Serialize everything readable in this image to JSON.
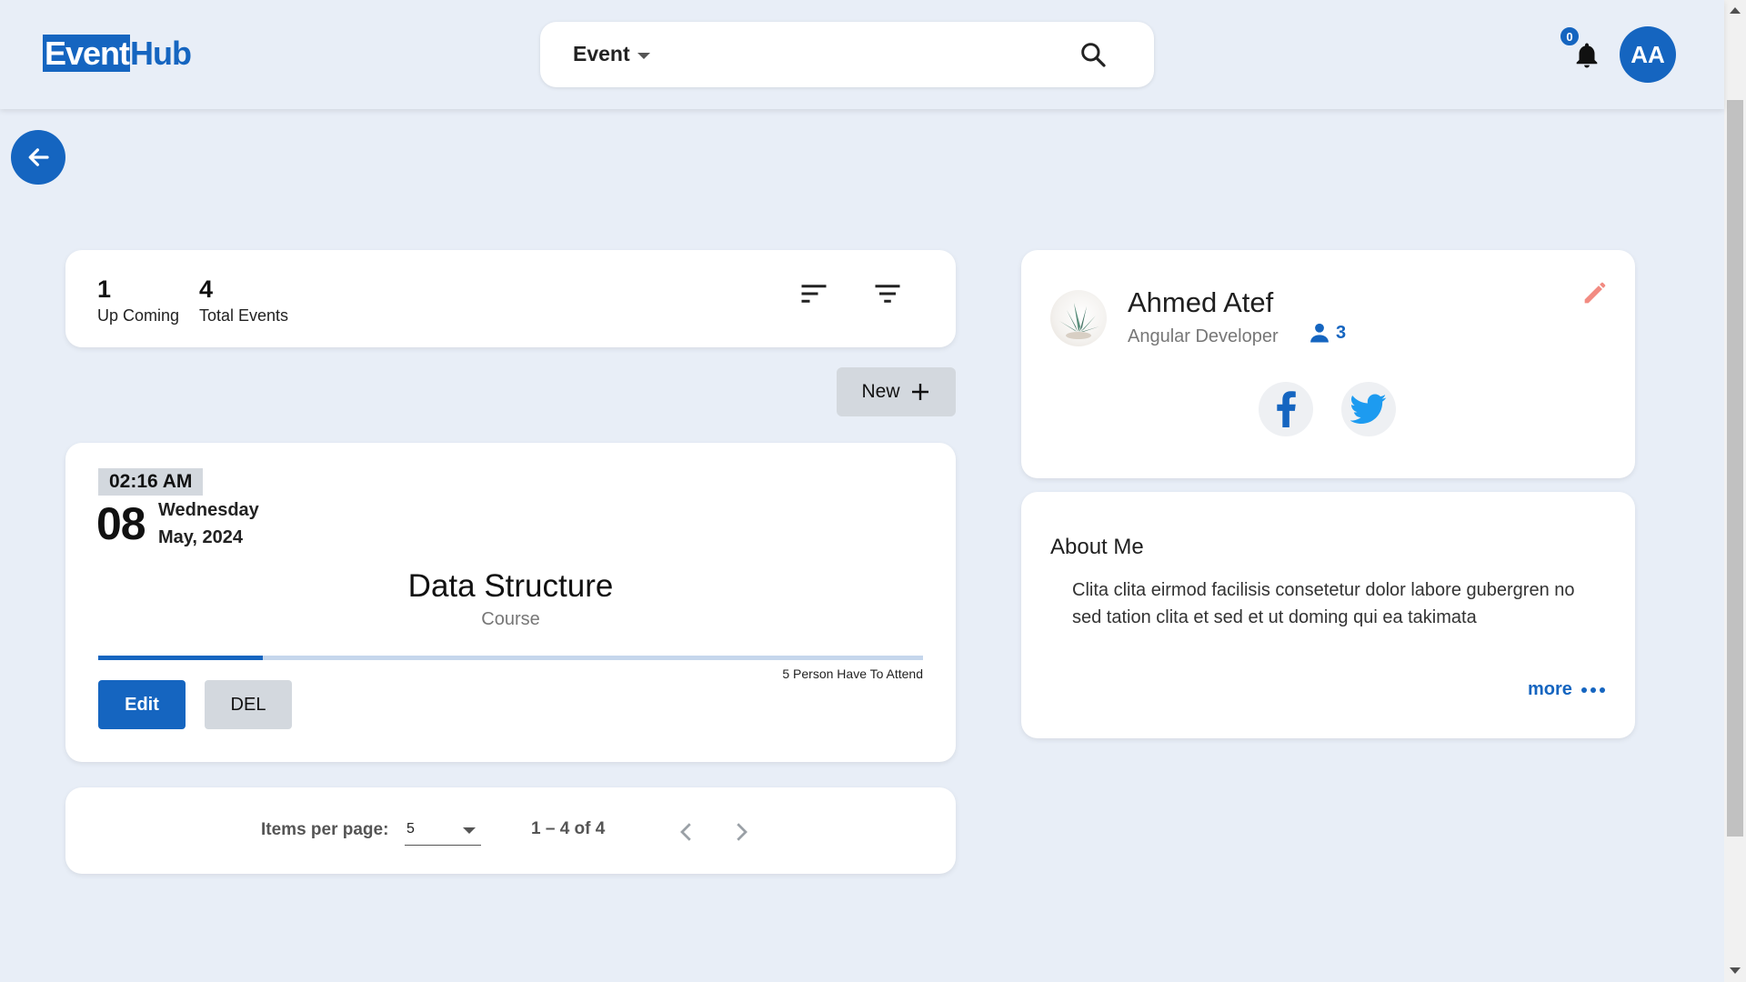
{
  "header": {
    "logo_part1": "Event",
    "logo_part2": "Hub",
    "search_type": "Event",
    "notification_count": "0",
    "avatar_initials": "AA"
  },
  "stats": {
    "upcoming_value": "1",
    "upcoming_label": "Up Coming",
    "total_value": "4",
    "total_label": "Total Events"
  },
  "new_button_label": "New",
  "event": {
    "time": "02:16 AM",
    "day": "08",
    "weekday": "Wednesday",
    "month_year": "May, 2024",
    "title": "Data Structure",
    "type": "Course",
    "attend_text": "5 Person Have To Attend",
    "progress_fraction": 0.2,
    "edit_label": "Edit",
    "delete_label": "DEL"
  },
  "paginator": {
    "items_per_page_label": "Items per page:",
    "items_per_page_value": "5",
    "range_label": "1 – 4 of 4"
  },
  "profile": {
    "name": "Ahmed Atef",
    "role": "Angular Developer",
    "followers": "3"
  },
  "about": {
    "title": "About Me",
    "text": "Clita clita eirmod facilisis consetetur dolor labore gubergren no sed tation clita et sed et ut doming qui ea takimata",
    "more_label": "more"
  },
  "colors": {
    "primary": "#1565c0",
    "background": "#e8eef7",
    "edit_pencil": "#f28b82"
  },
  "icons": [
    "search-icon",
    "bell-icon",
    "arrow-left-icon",
    "sort-icon",
    "filter-icon",
    "plus-icon",
    "chevron-left-icon",
    "chevron-right-icon",
    "person-icon",
    "pencil-icon",
    "facebook-icon",
    "twitter-icon",
    "more-dots-icon"
  ]
}
